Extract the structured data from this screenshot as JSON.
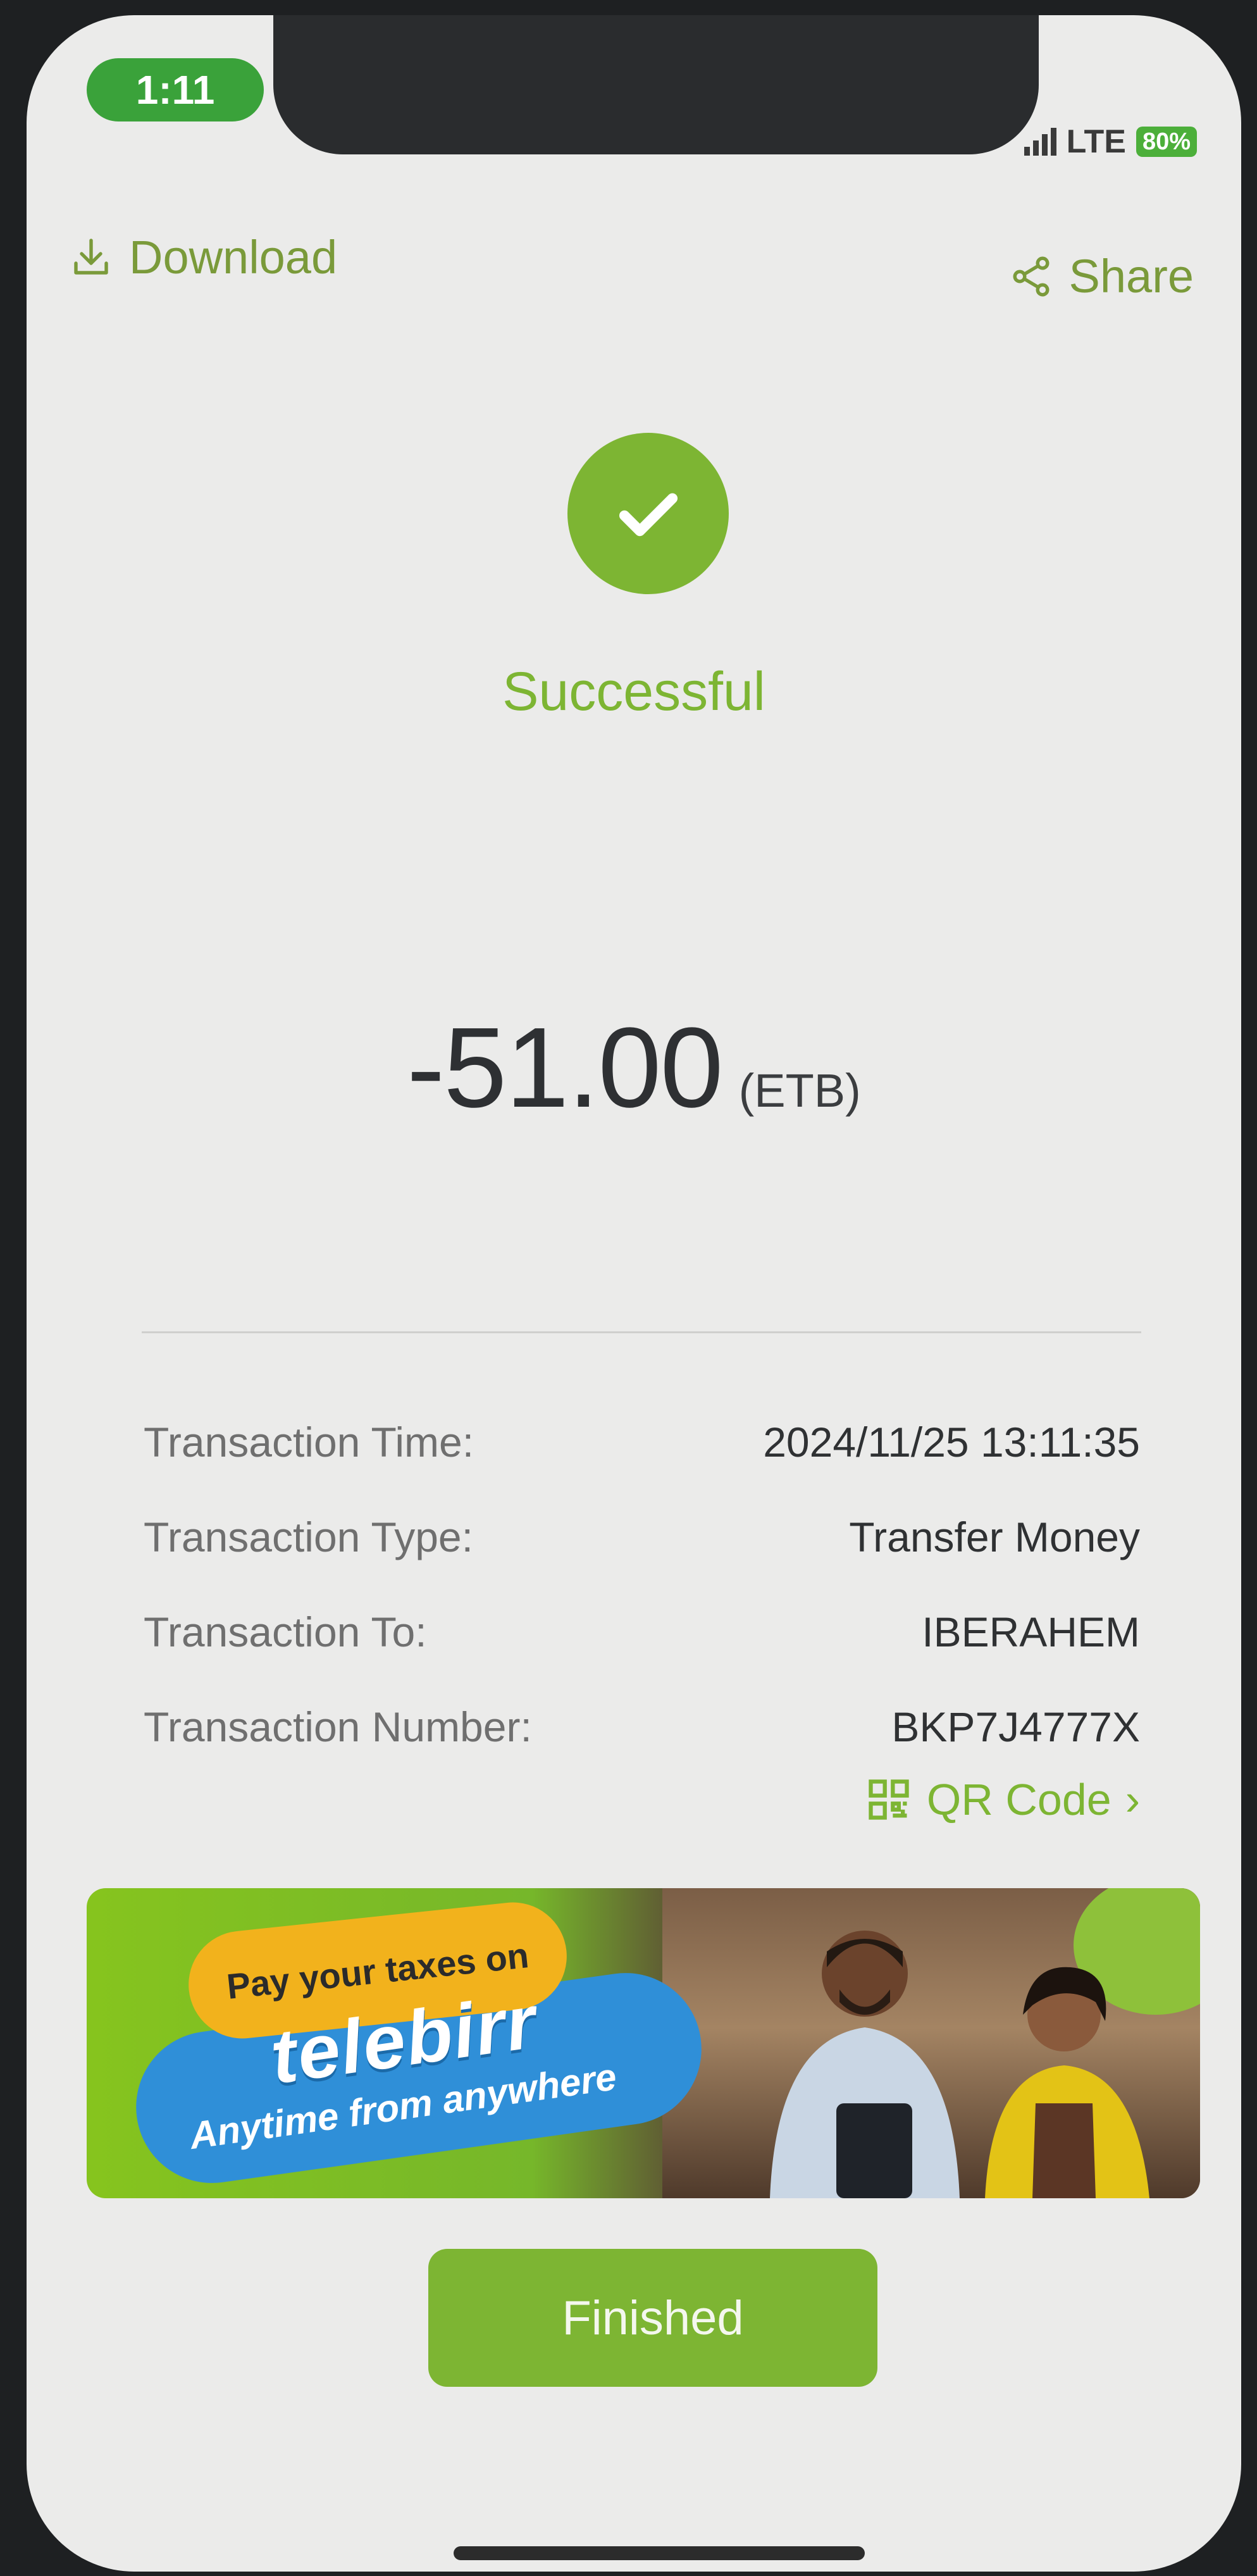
{
  "status_bar": {
    "time": "1:11",
    "network": "LTE",
    "battery": "80%"
  },
  "topbar": {
    "download_label": "Download",
    "share_label": "Share"
  },
  "result": {
    "status": "Successful",
    "amount": "-51.00",
    "currency": "(ETB)"
  },
  "details": [
    {
      "label": "Transaction Time:",
      "value": "2024/11/25 13:11:35"
    },
    {
      "label": "Transaction Type:",
      "value": "Transfer Money"
    },
    {
      "label": "Transaction To:",
      "value": "IBERAHEM"
    },
    {
      "label": "Transaction Number:",
      "value": "BKP7J4777X"
    }
  ],
  "qr_link": {
    "label": "QR Code",
    "chevron": "›"
  },
  "banner": {
    "line1": "Pay your taxes on",
    "brand": "telebirr",
    "tagline": "Anytime from anywhere"
  },
  "actions": {
    "finished_label": "Finished"
  },
  "colors": {
    "accent": "#7db533",
    "status_pill": "#3aa23a",
    "background": "#ebebea"
  },
  "icons": {
    "download": "download-icon",
    "share": "share-icon",
    "check": "checkmark-icon",
    "qr": "qr-code-icon"
  }
}
